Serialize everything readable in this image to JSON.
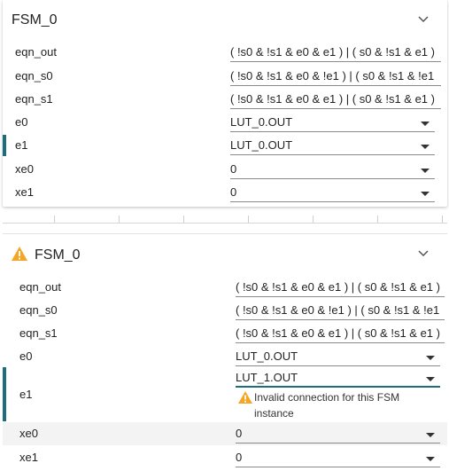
{
  "panels": [
    {
      "title": "FSM_0",
      "rows": [
        {
          "label": "eqn_out",
          "value": "( !s0 & !s1 & e0 & e1 ) | ( s0 & !s1 & e1 )"
        },
        {
          "label": "eqn_s0",
          "value": "( !s0 & !s1 & e0 & !e1 ) | ( s0 & !s1 & !e1"
        },
        {
          "label": "eqn_s1",
          "value": "( !s0 & !s1 & e0 & e1 ) | ( s0 & !s1 & e1 )"
        },
        {
          "label": "e0",
          "value": "LUT_0.OUT"
        },
        {
          "label": "e1",
          "value": "LUT_0.OUT"
        },
        {
          "label": "xe0",
          "value": "0"
        },
        {
          "label": "xe1",
          "value": "0"
        }
      ]
    },
    {
      "title": "FSM_0",
      "rows": [
        {
          "label": "eqn_out",
          "value": "( !s0 & !s1 & e0 & e1 ) | ( s0 & !s1 & e1 )"
        },
        {
          "label": "eqn_s0",
          "value": "( !s0 & !s1 & e0 & !e1 ) | ( s0 & !s1 & !e1"
        },
        {
          "label": "eqn_s1",
          "value": "( !s0 & !s1 & e0 & e1 ) | ( s0 & !s1 & e1 )"
        },
        {
          "label": "e0",
          "value": "LUT_0.OUT"
        },
        {
          "label": "e1",
          "value": "LUT_1.OUT"
        },
        {
          "label": "xe0",
          "value": "0"
        },
        {
          "label": "xe1",
          "value": "0"
        }
      ],
      "warning_line1": "Invalid connection for this FSM",
      "warning_line2": "instance"
    }
  ],
  "colors": {
    "accent": "#1c6e7d",
    "warning": "#f5a623"
  }
}
